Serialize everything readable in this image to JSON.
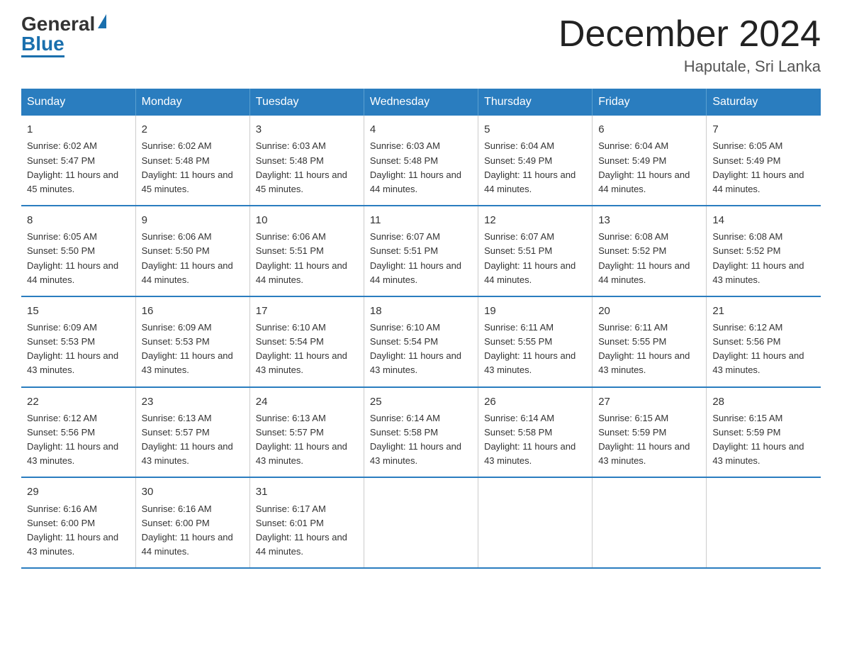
{
  "header": {
    "logo_general": "General",
    "logo_blue": "Blue",
    "main_title": "December 2024",
    "subtitle": "Haputale, Sri Lanka"
  },
  "weekdays": [
    "Sunday",
    "Monday",
    "Tuesday",
    "Wednesday",
    "Thursday",
    "Friday",
    "Saturday"
  ],
  "weeks": [
    [
      {
        "day": "1",
        "sunrise": "6:02 AM",
        "sunset": "5:47 PM",
        "daylight": "11 hours and 45 minutes."
      },
      {
        "day": "2",
        "sunrise": "6:02 AM",
        "sunset": "5:48 PM",
        "daylight": "11 hours and 45 minutes."
      },
      {
        "day": "3",
        "sunrise": "6:03 AM",
        "sunset": "5:48 PM",
        "daylight": "11 hours and 45 minutes."
      },
      {
        "day": "4",
        "sunrise": "6:03 AM",
        "sunset": "5:48 PM",
        "daylight": "11 hours and 44 minutes."
      },
      {
        "day": "5",
        "sunrise": "6:04 AM",
        "sunset": "5:49 PM",
        "daylight": "11 hours and 44 minutes."
      },
      {
        "day": "6",
        "sunrise": "6:04 AM",
        "sunset": "5:49 PM",
        "daylight": "11 hours and 44 minutes."
      },
      {
        "day": "7",
        "sunrise": "6:05 AM",
        "sunset": "5:49 PM",
        "daylight": "11 hours and 44 minutes."
      }
    ],
    [
      {
        "day": "8",
        "sunrise": "6:05 AM",
        "sunset": "5:50 PM",
        "daylight": "11 hours and 44 minutes."
      },
      {
        "day": "9",
        "sunrise": "6:06 AM",
        "sunset": "5:50 PM",
        "daylight": "11 hours and 44 minutes."
      },
      {
        "day": "10",
        "sunrise": "6:06 AM",
        "sunset": "5:51 PM",
        "daylight": "11 hours and 44 minutes."
      },
      {
        "day": "11",
        "sunrise": "6:07 AM",
        "sunset": "5:51 PM",
        "daylight": "11 hours and 44 minutes."
      },
      {
        "day": "12",
        "sunrise": "6:07 AM",
        "sunset": "5:51 PM",
        "daylight": "11 hours and 44 minutes."
      },
      {
        "day": "13",
        "sunrise": "6:08 AM",
        "sunset": "5:52 PM",
        "daylight": "11 hours and 44 minutes."
      },
      {
        "day": "14",
        "sunrise": "6:08 AM",
        "sunset": "5:52 PM",
        "daylight": "11 hours and 43 minutes."
      }
    ],
    [
      {
        "day": "15",
        "sunrise": "6:09 AM",
        "sunset": "5:53 PM",
        "daylight": "11 hours and 43 minutes."
      },
      {
        "day": "16",
        "sunrise": "6:09 AM",
        "sunset": "5:53 PM",
        "daylight": "11 hours and 43 minutes."
      },
      {
        "day": "17",
        "sunrise": "6:10 AM",
        "sunset": "5:54 PM",
        "daylight": "11 hours and 43 minutes."
      },
      {
        "day": "18",
        "sunrise": "6:10 AM",
        "sunset": "5:54 PM",
        "daylight": "11 hours and 43 minutes."
      },
      {
        "day": "19",
        "sunrise": "6:11 AM",
        "sunset": "5:55 PM",
        "daylight": "11 hours and 43 minutes."
      },
      {
        "day": "20",
        "sunrise": "6:11 AM",
        "sunset": "5:55 PM",
        "daylight": "11 hours and 43 minutes."
      },
      {
        "day": "21",
        "sunrise": "6:12 AM",
        "sunset": "5:56 PM",
        "daylight": "11 hours and 43 minutes."
      }
    ],
    [
      {
        "day": "22",
        "sunrise": "6:12 AM",
        "sunset": "5:56 PM",
        "daylight": "11 hours and 43 minutes."
      },
      {
        "day": "23",
        "sunrise": "6:13 AM",
        "sunset": "5:57 PM",
        "daylight": "11 hours and 43 minutes."
      },
      {
        "day": "24",
        "sunrise": "6:13 AM",
        "sunset": "5:57 PM",
        "daylight": "11 hours and 43 minutes."
      },
      {
        "day": "25",
        "sunrise": "6:14 AM",
        "sunset": "5:58 PM",
        "daylight": "11 hours and 43 minutes."
      },
      {
        "day": "26",
        "sunrise": "6:14 AM",
        "sunset": "5:58 PM",
        "daylight": "11 hours and 43 minutes."
      },
      {
        "day": "27",
        "sunrise": "6:15 AM",
        "sunset": "5:59 PM",
        "daylight": "11 hours and 43 minutes."
      },
      {
        "day": "28",
        "sunrise": "6:15 AM",
        "sunset": "5:59 PM",
        "daylight": "11 hours and 43 minutes."
      }
    ],
    [
      {
        "day": "29",
        "sunrise": "6:16 AM",
        "sunset": "6:00 PM",
        "daylight": "11 hours and 43 minutes."
      },
      {
        "day": "30",
        "sunrise": "6:16 AM",
        "sunset": "6:00 PM",
        "daylight": "11 hours and 44 minutes."
      },
      {
        "day": "31",
        "sunrise": "6:17 AM",
        "sunset": "6:01 PM",
        "daylight": "11 hours and 44 minutes."
      },
      null,
      null,
      null,
      null
    ]
  ]
}
